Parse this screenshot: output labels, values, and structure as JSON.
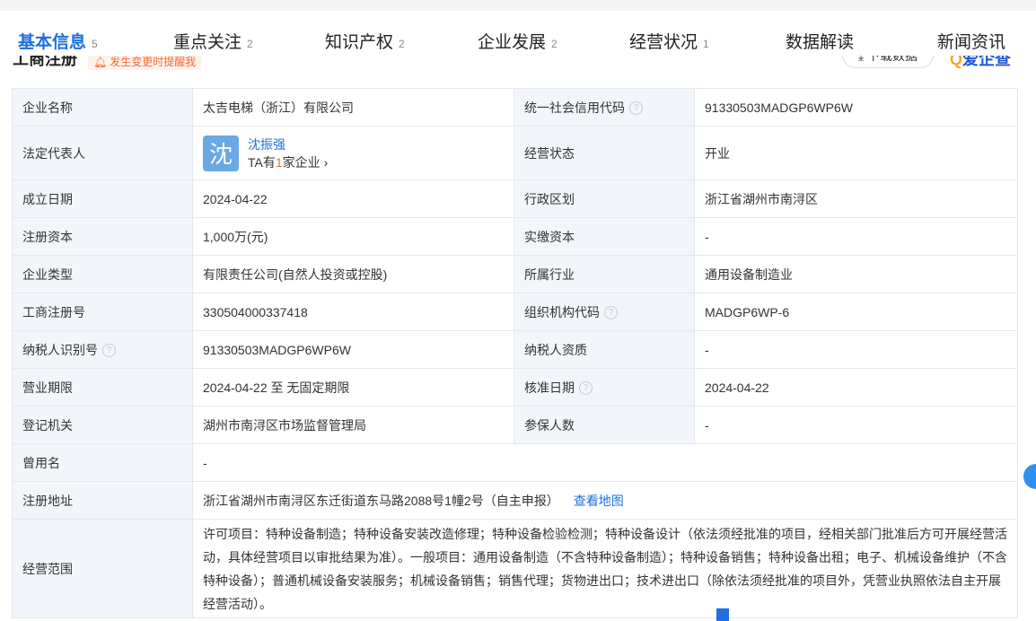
{
  "tabs": [
    {
      "label": "基本信息",
      "count": "5"
    },
    {
      "label": "重点关注",
      "count": "2"
    },
    {
      "label": "知识产权",
      "count": "2"
    },
    {
      "label": "企业发展",
      "count": "2"
    },
    {
      "label": "经营状况",
      "count": "1"
    },
    {
      "label": "数据解读",
      "count": ""
    },
    {
      "label": "新闻资讯",
      "count": ""
    }
  ],
  "section": {
    "title": "工商注册",
    "notify_label": "发生变更时提醒我",
    "download_label": "下载数据",
    "logo_q": "Q",
    "logo_text": "爱企查"
  },
  "info": {
    "company_name_label": "企业名称",
    "company_name": "太吉电梯（浙江）有限公司",
    "credit_code_label": "统一社会信用代码",
    "credit_code": "91330503MADGP6WP6W",
    "legal_rep_label": "法定代表人",
    "legal_rep_avatar": "沈",
    "legal_rep_name": "沈振强",
    "legal_rep_sub_prefix": "TA有",
    "legal_rep_sub_num": "1",
    "legal_rep_sub_suffix": "家企业",
    "status_label": "经营状态",
    "status": "开业",
    "founded_label": "成立日期",
    "founded": "2024-04-22",
    "region_label": "行政区划",
    "region": "浙江省湖州市南浔区",
    "reg_capital_label": "注册资本",
    "reg_capital": "1,000万(元)",
    "paid_capital_label": "实缴资本",
    "paid_capital": "-",
    "type_label": "企业类型",
    "type": "有限责任公司(自然人投资或控股)",
    "industry_label": "所属行业",
    "industry": "通用设备制造业",
    "reg_no_label": "工商注册号",
    "reg_no": "330504000337418",
    "org_code_label": "组织机构代码",
    "org_code": "MADGP6WP-6",
    "taxpayer_id_label": "纳税人识别号",
    "taxpayer_id": "91330503MADGP6WP6W",
    "taxpayer_qual_label": "纳税人资质",
    "taxpayer_qual": "-",
    "term_label": "营业期限",
    "term": "2024-04-22 至 无固定期限",
    "approval_label": "核准日期",
    "approval": "2024-04-22",
    "authority_label": "登记机关",
    "authority": "湖州市南浔区市场监督管理局",
    "insured_label": "参保人数",
    "insured": "-",
    "former_name_label": "曾用名",
    "former_name": "-",
    "address_label": "注册地址",
    "address": "浙江省湖州市南浔区东迁街道东马路2088号1幢2号（自主申报）",
    "map_link": "查看地图",
    "scope_label": "经营范围",
    "scope": "许可项目：特种设备制造；特种设备安装改造修理；特种设备检验检测；特种设备设计（依法须经批准的项目，经相关部门批准后方可开展经营活动，具体经营项目以审批结果为准）。一般项目：通用设备制造（不含特种设备制造）；特种设备销售；特种设备出租；电子、机械设备维护（不含特种设备）；普通机械设备安装服务；机械设备销售；销售代理；货物进出口；技术进出口（除依法须经批准的项目外，凭营业执照依法自主开展经营活动）。"
  },
  "help_glyph": "?",
  "colors": {
    "accent": "#1f6fe0",
    "label_bg": "#f2f5fa",
    "notify": "#f26b3a"
  }
}
